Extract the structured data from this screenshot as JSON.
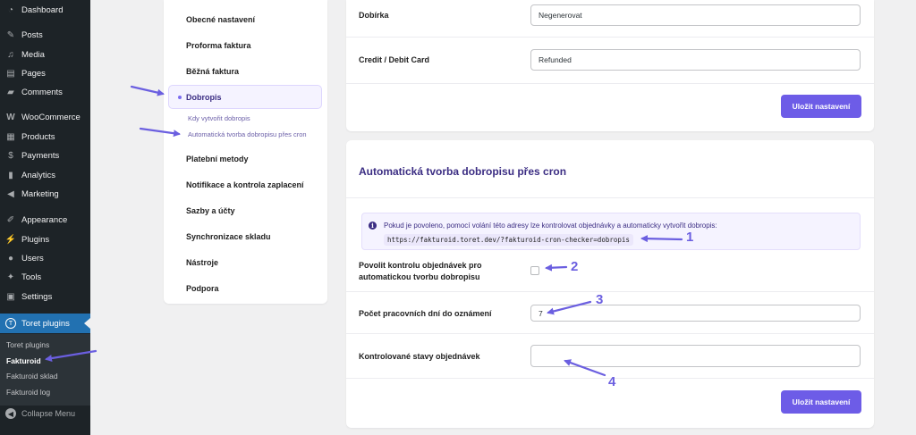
{
  "wp_menu": {
    "items": [
      {
        "label": "Dashboard",
        "icon": "dashboard-icon"
      },
      {
        "label": "Posts",
        "icon": "pin-icon"
      },
      {
        "label": "Media",
        "icon": "media-icon"
      },
      {
        "label": "Pages",
        "icon": "page-icon"
      },
      {
        "label": "Comments",
        "icon": "comment-icon"
      },
      {
        "label": "WooCommerce",
        "icon": "woo-icon"
      },
      {
        "label": "Products",
        "icon": "archive-icon"
      },
      {
        "label": "Payments",
        "icon": "dollar-icon"
      },
      {
        "label": "Analytics",
        "icon": "chart-icon"
      },
      {
        "label": "Marketing",
        "icon": "megaphone-icon"
      },
      {
        "label": "Appearance",
        "icon": "brush-icon"
      },
      {
        "label": "Plugins",
        "icon": "plug-icon"
      },
      {
        "label": "Users",
        "icon": "user-icon"
      },
      {
        "label": "Tools",
        "icon": "wrench-icon"
      },
      {
        "label": "Settings",
        "icon": "sliders-icon"
      }
    ],
    "active": {
      "label": "Toret plugins",
      "icon": "toret-logo-icon",
      "glyph": "T"
    },
    "submenu": [
      {
        "label": "Toret plugins"
      },
      {
        "label": "Fakturoid"
      },
      {
        "label": "Fakturoid sklad"
      },
      {
        "label": "Fakturoid log"
      }
    ],
    "collapse_label": "Collapse Menu"
  },
  "plugin_nav": {
    "items_top": [
      "Obecné nastavení",
      "Proforma faktura",
      "Běžná faktura"
    ],
    "active_label": "Dobropis",
    "subitems": [
      "Kdy vytvořit dobropis",
      "Automatická tvorba dobropisu přes cron"
    ],
    "items_bottom": [
      "Platební metody",
      "Notifikace a kontrola zaplacení",
      "Sazby a účty",
      "Synchronizace skladu",
      "Nástroje",
      "Podpora"
    ]
  },
  "card1": {
    "rows": [
      {
        "label": "Dobírka",
        "value": "Negenerovat"
      },
      {
        "label": "Credit / Debit Card",
        "value": "Refunded"
      }
    ],
    "save_label": "Uložit nastavení"
  },
  "card2": {
    "title": "Automatická tvorba dobropisu přes cron",
    "info_text": "Pokud je povoleno, pomocí volání této adresy lze kontrolovat objednávky a automaticky vytvořit dobropis:",
    "info_url": "https://fakturoid.toret.dev/?fakturoid-cron-checker=dobropis",
    "checkbox_label": "Povolit kontrolu objednávek pro automatickou tvorbu dobropisu",
    "days_label": "Počet pracovních dní do oznámení",
    "days_value": "7",
    "statuses_label": "Kontrolované stavy objednávek",
    "statuses_value": "",
    "save_label": "Uložit nastavení"
  },
  "annotations": [
    "1",
    "2",
    "3",
    "4"
  ],
  "colors": {
    "accent": "#6d5ce7",
    "wp_active": "#2271b1",
    "wp_sidebar": "#1d2327",
    "annotation": "#6b5fe0"
  }
}
